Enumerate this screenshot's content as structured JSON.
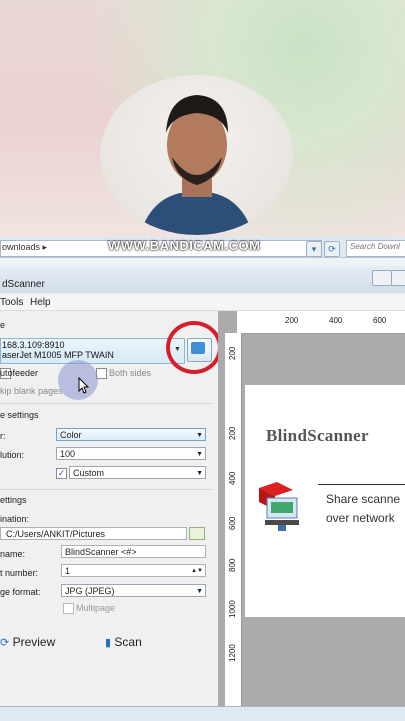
{
  "overlay": {
    "watermark": "WWW.BANDICAM.COM"
  },
  "browser": {
    "address_text": "ownloads ▸",
    "search_placeholder": "Search Downl"
  },
  "window": {
    "title": "dScanner",
    "menu": [
      "Tools",
      "Help"
    ]
  },
  "device": {
    "section_label": "e",
    "line1": "168.3.109:8910",
    "line2": "aserJet M1005 MFP TWAIN"
  },
  "paper_source": {
    "autofeeder_label": "utofeeder",
    "both_sides_label": "Both sides",
    "skip_blank_label": "kip blank pages"
  },
  "image_settings": {
    "section_label": "e settings",
    "color_label": "r:",
    "color_value": "Color",
    "resolution_label": "lution:",
    "resolution_value": "100",
    "custom_value": "Custom"
  },
  "output_settings": {
    "section_label": "ettings",
    "destination_label": "ination:",
    "destination_value": "C:/Users/ANKIT/Pictures",
    "filename_label": "name:",
    "filename_value": "BlindScanner <#>",
    "start_number_label": "t number:",
    "start_number_value": "1",
    "format_label": "ge format:",
    "format_value": "JPG (JPEG)",
    "multipage_label": "Multipage"
  },
  "actions": {
    "preview_label": "Preview",
    "scan_label": "Scan"
  },
  "rulers": {
    "top": [
      "200",
      "400",
      "600"
    ],
    "left": [
      "200",
      "200",
      "400",
      "600",
      "800",
      "1000",
      "1200"
    ]
  },
  "preview": {
    "title": "BlindScanner",
    "line1": "Share scanne",
    "line2": "over network"
  },
  "colors": {
    "accent_red": "#d3202a",
    "accent_blue": "#3d8fd6"
  }
}
